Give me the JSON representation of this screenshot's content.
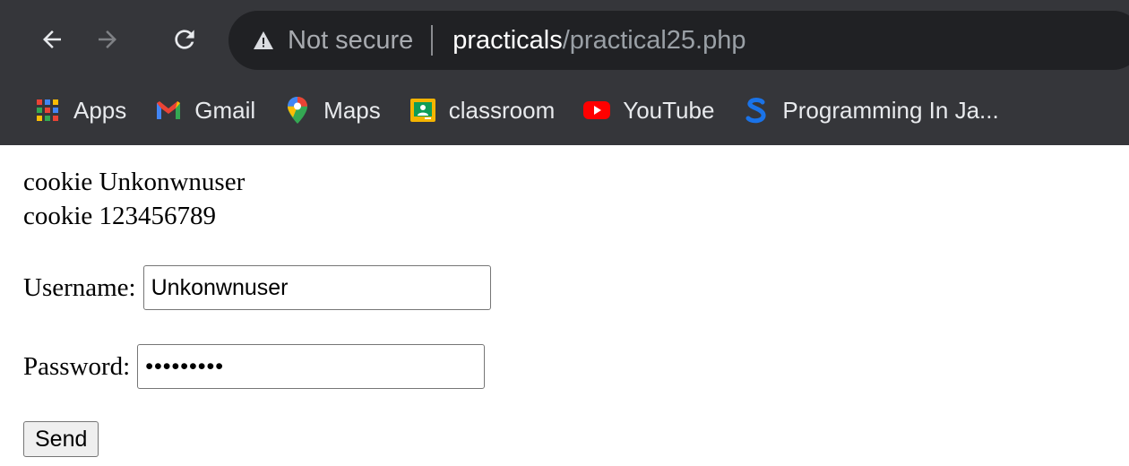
{
  "browser": {
    "security_text": "Not secure",
    "url_host": "practicals",
    "url_path": "/practical25.php",
    "icons": {
      "back": "arrow-left-icon",
      "forward": "arrow-right-icon",
      "reload": "reload-icon",
      "security": "warning-triangle-icon"
    }
  },
  "bookmarks": [
    {
      "label": "Apps",
      "icon": "apps-grid-icon"
    },
    {
      "label": "Gmail",
      "icon": "gmail-icon"
    },
    {
      "label": "Maps",
      "icon": "maps-pin-icon"
    },
    {
      "label": "classroom",
      "icon": "classroom-icon"
    },
    {
      "label": "YouTube",
      "icon": "youtube-icon"
    },
    {
      "label": "Programming In Ja...",
      "icon": "s-logo-icon"
    }
  ],
  "page": {
    "cookie_lines": [
      "cookie Unkonwnuser",
      "cookie 123456789"
    ],
    "form": {
      "username_label": "Username:",
      "username_value": "Unkonwnuser",
      "password_label": "Password:",
      "password_value": "123456789",
      "submit_label": "Send"
    }
  },
  "colors": {
    "chrome_bg": "#35363a",
    "omnibox_bg": "#202124",
    "youtube_red": "#ff0000",
    "classroom_yellow": "#f4b400",
    "s_logo_blue": "#1a73e8"
  }
}
